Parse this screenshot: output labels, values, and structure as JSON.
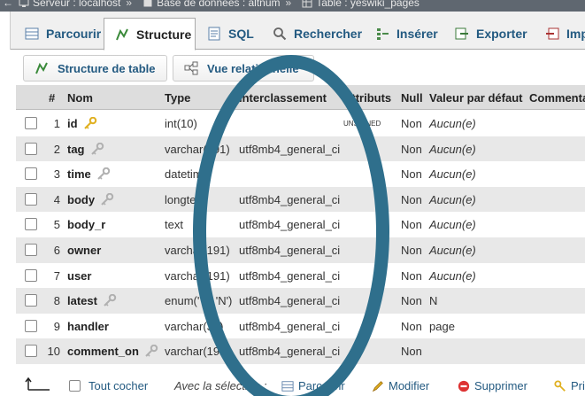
{
  "breadcrumb": {
    "back": "←",
    "items": [
      {
        "icon": "server-icon",
        "label": "Serveur : localhost"
      },
      {
        "icon": "database-icon",
        "label": "Base de données : altnum"
      },
      {
        "icon": "table-icon",
        "label": "Table : yeswiki_pages"
      }
    ],
    "separator": "»"
  },
  "tabs": [
    {
      "icon": "browse-icon",
      "label": "Parcourir",
      "active": false
    },
    {
      "icon": "structure-icon",
      "label": "Structure",
      "active": true
    },
    {
      "icon": "sql-icon",
      "label": "SQL",
      "active": false
    },
    {
      "icon": "search-icon",
      "label": "Rechercher",
      "active": false
    },
    {
      "icon": "insert-icon",
      "label": "Insérer",
      "active": false
    },
    {
      "icon": "export-icon",
      "label": "Exporter",
      "active": false
    },
    {
      "icon": "import-icon",
      "label": "Imp",
      "active": false
    }
  ],
  "subtabs": [
    {
      "icon": "table-structure-icon",
      "label": "Structure de table"
    },
    {
      "icon": "relation-icon",
      "label": "Vue relationnelle"
    }
  ],
  "columns": {
    "hash": "#",
    "nom": "Nom",
    "type": "Type",
    "interclassement": "Interclassement",
    "attributs": "Attributs",
    "null": "Null",
    "defaut": "Valeur par défaut",
    "comment": "Commentaires"
  },
  "rows": [
    {
      "num": "1",
      "nom": "id",
      "key": "primary",
      "type": "int(10)",
      "inter": "",
      "attr": "UNSIGNED",
      "null": "Non",
      "def": "Aucun(e)",
      "defItalic": true
    },
    {
      "num": "2",
      "nom": "tag",
      "key": "index",
      "type": "varchar(191)",
      "inter": "utf8mb4_general_ci",
      "attr": "",
      "null": "Non",
      "def": "Aucun(e)",
      "defItalic": true
    },
    {
      "num": "3",
      "nom": "time",
      "key": "index",
      "type": "datetime",
      "inter": "",
      "attr": "",
      "null": "Non",
      "def": "Aucun(e)",
      "defItalic": true
    },
    {
      "num": "4",
      "nom": "body",
      "key": "index",
      "type": "longtext",
      "inter": "utf8mb4_general_ci",
      "attr": "",
      "null": "Non",
      "def": "Aucun(e)",
      "defItalic": true
    },
    {
      "num": "5",
      "nom": "body_r",
      "key": "",
      "type": "text",
      "inter": "utf8mb4_general_ci",
      "attr": "",
      "null": "Non",
      "def": "Aucun(e)",
      "defItalic": true
    },
    {
      "num": "6",
      "nom": "owner",
      "key": "",
      "type": "varchar(191)",
      "inter": "utf8mb4_general_ci",
      "attr": "",
      "null": "Non",
      "def": "Aucun(e)",
      "defItalic": true
    },
    {
      "num": "7",
      "nom": "user",
      "key": "",
      "type": "varchar(191)",
      "inter": "utf8mb4_general_ci",
      "attr": "",
      "null": "Non",
      "def": "Aucun(e)",
      "defItalic": true
    },
    {
      "num": "8",
      "nom": "latest",
      "key": "index",
      "type": "enum('Y', 'N')",
      "inter": "utf8mb4_general_ci",
      "attr": "",
      "null": "Non",
      "def": "N",
      "defItalic": false
    },
    {
      "num": "9",
      "nom": "handler",
      "key": "",
      "type": "varchar(30)",
      "inter": "utf8mb4_general_ci",
      "attr": "",
      "null": "Non",
      "def": "page",
      "defItalic": false
    },
    {
      "num": "10",
      "nom": "comment_on",
      "key": "index",
      "type": "varchar(191)",
      "inter": "utf8mb4_general_ci",
      "attr": "",
      "null": "Non",
      "def": "",
      "defItalic": false
    }
  ],
  "footer": {
    "check_all": "Tout cocher",
    "with_selection": "Avec la sélection :",
    "actions": [
      {
        "icon": "browse-icon",
        "label": "Parcourir"
      },
      {
        "icon": "edit-icon",
        "label": "Modifier"
      },
      {
        "icon": "delete-icon",
        "label": "Supprimer"
      },
      {
        "icon": "primary-icon",
        "label": "Pri"
      }
    ]
  },
  "colors": {
    "link": "#235a81",
    "ellipse": "#2f6f8c",
    "key_gold": "#e0b020",
    "key_gray": "#b0b0b0"
  }
}
